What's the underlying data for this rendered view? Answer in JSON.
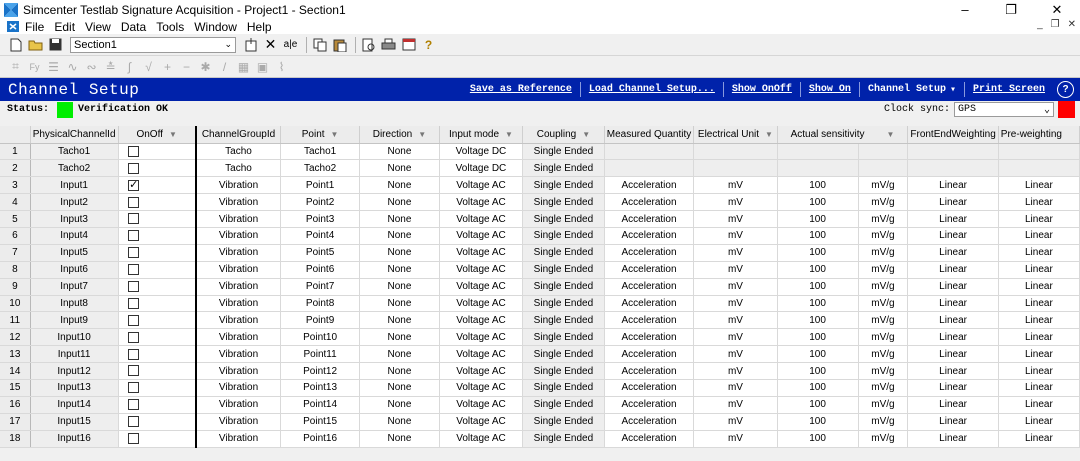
{
  "window": {
    "title": "Simcenter Testlab Signature Acquisition - Project1 - Section1"
  },
  "menu": [
    "File",
    "Edit",
    "View",
    "Data",
    "Tools",
    "Window",
    "Help"
  ],
  "toolbar": {
    "section_value": "Section1"
  },
  "header": {
    "title": "Channel Setup",
    "links": [
      "Save as Reference",
      "Load Channel Setup...",
      "Show OnOff",
      "Show On",
      "Channel Setup",
      "Print Screen"
    ]
  },
  "status": {
    "label": "Status:",
    "text": "Verification OK",
    "clock_label": "Clock sync:",
    "clock_value": "GPS",
    "colors": {
      "status_ok": "#00ee00",
      "clock_sync": "#ff0000"
    }
  },
  "table": {
    "columns": [
      "PhysicalChannelId",
      "OnOff",
      "ChannelGroupId",
      "Point",
      "Direction",
      "Input mode",
      "Coupling",
      "Measured Quantity",
      "Electrical Unit",
      "Actual sensitivity",
      "FrontEndWeighting",
      "Pre-weighting"
    ],
    "rows": [
      {
        "n": "1",
        "id": "Tacho1",
        "on": false,
        "group": "Tacho",
        "point": "Tacho1",
        "dir": "None",
        "mode": "Voltage DC",
        "coup": "Single Ended",
        "mq": "",
        "eu": "",
        "sens": "",
        "sunit": "",
        "few": "",
        "pw": ""
      },
      {
        "n": "2",
        "id": "Tacho2",
        "on": false,
        "group": "Tacho",
        "point": "Tacho2",
        "dir": "None",
        "mode": "Voltage DC",
        "coup": "Single Ended",
        "mq": "",
        "eu": "",
        "sens": "",
        "sunit": "",
        "few": "",
        "pw": ""
      },
      {
        "n": "3",
        "id": "Input1",
        "on": true,
        "group": "Vibration",
        "point": "Point1",
        "dir": "None",
        "mode": "Voltage AC",
        "coup": "Single Ended",
        "mq": "Acceleration",
        "eu": "mV",
        "sens": "100",
        "sunit": "mV/g",
        "few": "Linear",
        "pw": "Linear"
      },
      {
        "n": "4",
        "id": "Input2",
        "on": false,
        "group": "Vibration",
        "point": "Point2",
        "dir": "None",
        "mode": "Voltage AC",
        "coup": "Single Ended",
        "mq": "Acceleration",
        "eu": "mV",
        "sens": "100",
        "sunit": "mV/g",
        "few": "Linear",
        "pw": "Linear"
      },
      {
        "n": "5",
        "id": "Input3",
        "on": false,
        "group": "Vibration",
        "point": "Point3",
        "dir": "None",
        "mode": "Voltage AC",
        "coup": "Single Ended",
        "mq": "Acceleration",
        "eu": "mV",
        "sens": "100",
        "sunit": "mV/g",
        "few": "Linear",
        "pw": "Linear"
      },
      {
        "n": "6",
        "id": "Input4",
        "on": false,
        "group": "Vibration",
        "point": "Point4",
        "dir": "None",
        "mode": "Voltage AC",
        "coup": "Single Ended",
        "mq": "Acceleration",
        "eu": "mV",
        "sens": "100",
        "sunit": "mV/g",
        "few": "Linear",
        "pw": "Linear"
      },
      {
        "n": "7",
        "id": "Input5",
        "on": false,
        "group": "Vibration",
        "point": "Point5",
        "dir": "None",
        "mode": "Voltage AC",
        "coup": "Single Ended",
        "mq": "Acceleration",
        "eu": "mV",
        "sens": "100",
        "sunit": "mV/g",
        "few": "Linear",
        "pw": "Linear"
      },
      {
        "n": "8",
        "id": "Input6",
        "on": false,
        "group": "Vibration",
        "point": "Point6",
        "dir": "None",
        "mode": "Voltage AC",
        "coup": "Single Ended",
        "mq": "Acceleration",
        "eu": "mV",
        "sens": "100",
        "sunit": "mV/g",
        "few": "Linear",
        "pw": "Linear"
      },
      {
        "n": "9",
        "id": "Input7",
        "on": false,
        "group": "Vibration",
        "point": "Point7",
        "dir": "None",
        "mode": "Voltage AC",
        "coup": "Single Ended",
        "mq": "Acceleration",
        "eu": "mV",
        "sens": "100",
        "sunit": "mV/g",
        "few": "Linear",
        "pw": "Linear"
      },
      {
        "n": "10",
        "id": "Input8",
        "on": false,
        "group": "Vibration",
        "point": "Point8",
        "dir": "None",
        "mode": "Voltage AC",
        "coup": "Single Ended",
        "mq": "Acceleration",
        "eu": "mV",
        "sens": "100",
        "sunit": "mV/g",
        "few": "Linear",
        "pw": "Linear"
      },
      {
        "n": "11",
        "id": "Input9",
        "on": false,
        "group": "Vibration",
        "point": "Point9",
        "dir": "None",
        "mode": "Voltage AC",
        "coup": "Single Ended",
        "mq": "Acceleration",
        "eu": "mV",
        "sens": "100",
        "sunit": "mV/g",
        "few": "Linear",
        "pw": "Linear"
      },
      {
        "n": "12",
        "id": "Input10",
        "on": false,
        "group": "Vibration",
        "point": "Point10",
        "dir": "None",
        "mode": "Voltage AC",
        "coup": "Single Ended",
        "mq": "Acceleration",
        "eu": "mV",
        "sens": "100",
        "sunit": "mV/g",
        "few": "Linear",
        "pw": "Linear"
      },
      {
        "n": "13",
        "id": "Input11",
        "on": false,
        "group": "Vibration",
        "point": "Point11",
        "dir": "None",
        "mode": "Voltage AC",
        "coup": "Single Ended",
        "mq": "Acceleration",
        "eu": "mV",
        "sens": "100",
        "sunit": "mV/g",
        "few": "Linear",
        "pw": "Linear"
      },
      {
        "n": "14",
        "id": "Input12",
        "on": false,
        "group": "Vibration",
        "point": "Point12",
        "dir": "None",
        "mode": "Voltage AC",
        "coup": "Single Ended",
        "mq": "Acceleration",
        "eu": "mV",
        "sens": "100",
        "sunit": "mV/g",
        "few": "Linear",
        "pw": "Linear"
      },
      {
        "n": "15",
        "id": "Input13",
        "on": false,
        "group": "Vibration",
        "point": "Point13",
        "dir": "None",
        "mode": "Voltage AC",
        "coup": "Single Ended",
        "mq": "Acceleration",
        "eu": "mV",
        "sens": "100",
        "sunit": "mV/g",
        "few": "Linear",
        "pw": "Linear"
      },
      {
        "n": "16",
        "id": "Input14",
        "on": false,
        "group": "Vibration",
        "point": "Point14",
        "dir": "None",
        "mode": "Voltage AC",
        "coup": "Single Ended",
        "mq": "Acceleration",
        "eu": "mV",
        "sens": "100",
        "sunit": "mV/g",
        "few": "Linear",
        "pw": "Linear"
      },
      {
        "n": "17",
        "id": "Input15",
        "on": false,
        "group": "Vibration",
        "point": "Point15",
        "dir": "None",
        "mode": "Voltage AC",
        "coup": "Single Ended",
        "mq": "Acceleration",
        "eu": "mV",
        "sens": "100",
        "sunit": "mV/g",
        "few": "Linear",
        "pw": "Linear"
      },
      {
        "n": "18",
        "id": "Input16",
        "on": false,
        "group": "Vibration",
        "point": "Point16",
        "dir": "None",
        "mode": "Voltage AC",
        "coup": "Single Ended",
        "mq": "Acceleration",
        "eu": "mV",
        "sens": "100",
        "sunit": "mV/g",
        "few": "Linear",
        "pw": "Linear"
      }
    ]
  }
}
